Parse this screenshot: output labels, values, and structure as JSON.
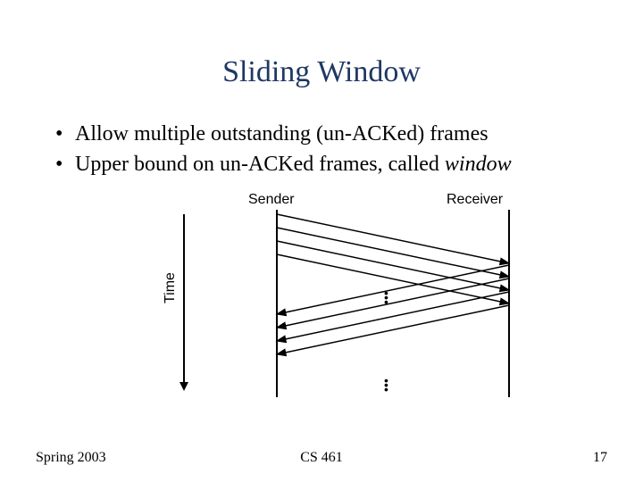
{
  "title": "Sliding Window",
  "bullets": [
    {
      "prefix": "Allow multiple outstanding (un-ACKed) frames",
      "italic": ""
    },
    {
      "prefix": "Upper bound on un-ACKed frames, called ",
      "italic": "window"
    }
  ],
  "diagram": {
    "sender_label": "Sender",
    "receiver_label": "Receiver",
    "time_label": "Time"
  },
  "footer": {
    "left": "Spring 2003",
    "center": "CS 461",
    "right": "17"
  }
}
